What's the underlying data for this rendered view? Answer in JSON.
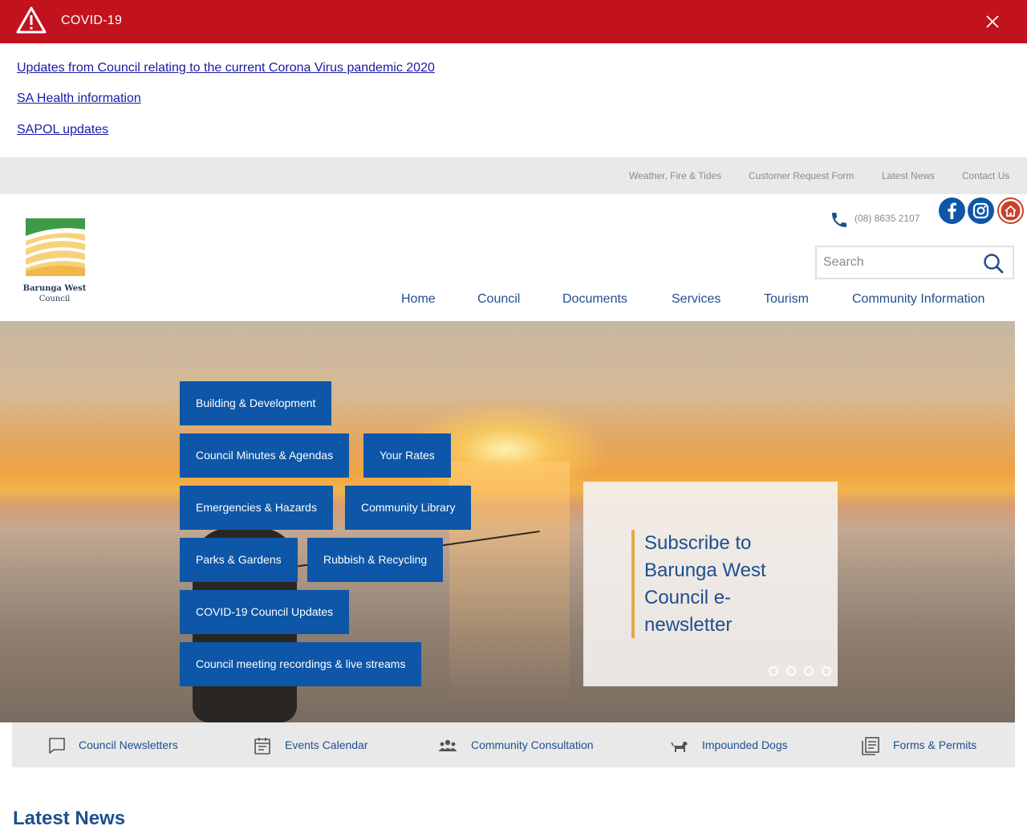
{
  "alert": {
    "title": "COVID-19",
    "links": [
      "Updates from Council relating to the current Corona Virus pandemic 2020",
      "SA Health information",
      "SAPOL updates"
    ]
  },
  "utility_links": [
    "Weather, Fire & Tides",
    "Customer Request Form",
    "Latest News",
    "Contact Us"
  ],
  "logo": {
    "line1": "Barunga West",
    "line2": "Council"
  },
  "contact": {
    "phone": "(08) 8635 2107"
  },
  "search": {
    "placeholder": "Search"
  },
  "nav": [
    "Home",
    "Council",
    "Documents",
    "Services",
    "Tourism",
    "Community Information"
  ],
  "hero": {
    "tiles": [
      "Building & Development",
      "Council Minutes & Agendas",
      "Your Rates",
      "Emergencies & Hazards",
      "Community Library",
      "Parks & Gardens",
      "Rubbish & Recycling",
      "COVID-19 Council Updates",
      "Council meeting recordings & live streams"
    ],
    "subscribe_text": "Subscribe to Barunga West Council e-newsletter",
    "slide_count": 4
  },
  "quick_links": [
    {
      "label": "Council Newsletters",
      "icon": "speech-bubble-icon"
    },
    {
      "label": "Events Calendar",
      "icon": "calendar-icon"
    },
    {
      "label": "Community Consultation",
      "icon": "people-icon"
    },
    {
      "label": "Impounded Dogs",
      "icon": "dog-icon"
    },
    {
      "label": "Forms & Permits",
      "icon": "documents-icon"
    }
  ],
  "latest_news": {
    "heading": "Latest News"
  },
  "colors": {
    "alert_red": "#c2121d",
    "brand_blue": "#0d56a8",
    "nav_blue": "#1e4f8e",
    "accent_gold": "#e5a84a"
  }
}
